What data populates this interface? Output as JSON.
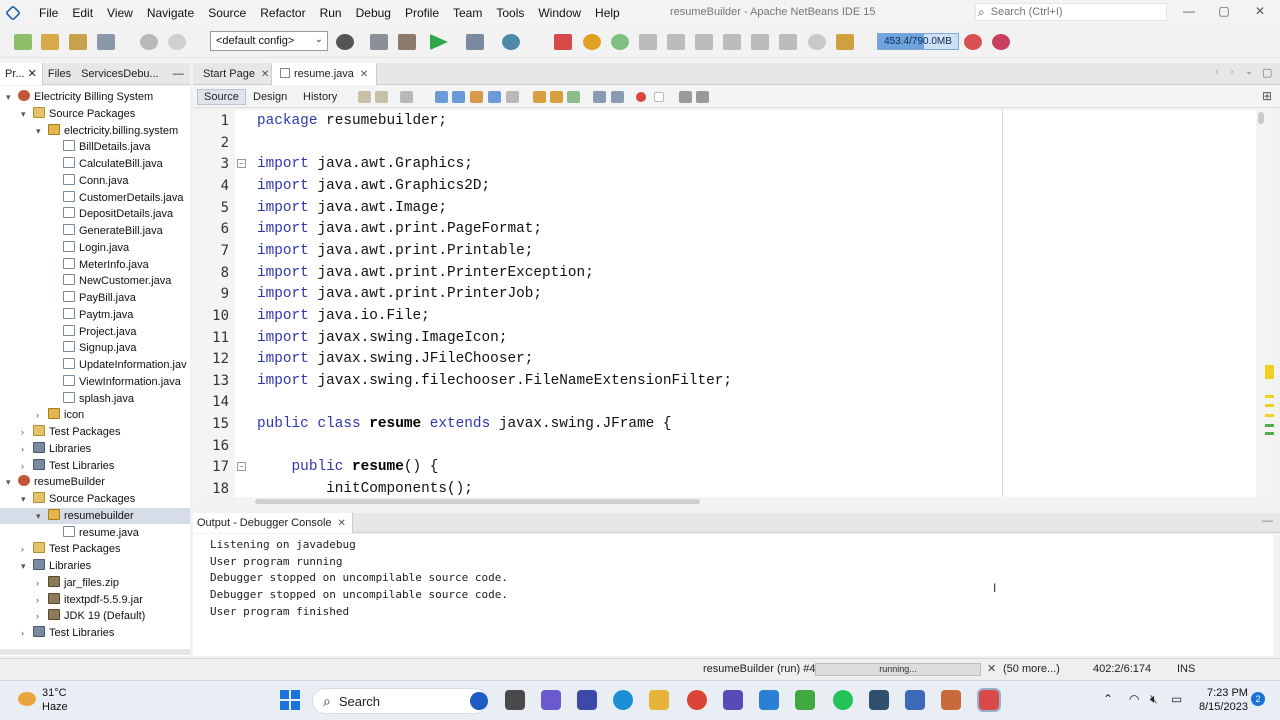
{
  "window": {
    "title": "resumeBuilder - Apache NetBeans IDE 15",
    "search_placeholder": "Search (Ctrl+I)"
  },
  "menu": [
    "File",
    "Edit",
    "View",
    "Navigate",
    "Source",
    "Refactor",
    "Run",
    "Debug",
    "Profile",
    "Team",
    "Tools",
    "Window",
    "Help"
  ],
  "toolbar": {
    "config": "<default config>",
    "memory": "453.4/790.0MB",
    "memory_fraction": 0.57
  },
  "projects_panel": {
    "tabs": [
      "Pr...",
      "Files",
      "ServicesDebu..."
    ],
    "tree": [
      {
        "label": "Electricity Billing System",
        "indent": 0,
        "icon": "project-icon",
        "twisty": "open"
      },
      {
        "label": "Source Packages",
        "indent": 1,
        "icon": "package-folder-icon",
        "twisty": "open"
      },
      {
        "label": "electricity.billing.system",
        "indent": 2,
        "icon": "package-icon",
        "twisty": "open"
      },
      {
        "label": "BillDetails.java",
        "indent": 3,
        "icon": "java-file-icon"
      },
      {
        "label": "CalculateBill.java",
        "indent": 3,
        "icon": "java-file-icon"
      },
      {
        "label": "Conn.java",
        "indent": 3,
        "icon": "java-file-icon"
      },
      {
        "label": "CustomerDetails.java",
        "indent": 3,
        "icon": "java-file-icon"
      },
      {
        "label": "DepositDetails.java",
        "indent": 3,
        "icon": "java-file-icon"
      },
      {
        "label": "GenerateBill.java",
        "indent": 3,
        "icon": "java-file-icon"
      },
      {
        "label": "Login.java",
        "indent": 3,
        "icon": "java-file-icon"
      },
      {
        "label": "MeterInfo.java",
        "indent": 3,
        "icon": "java-file-icon"
      },
      {
        "label": "NewCustomer.java",
        "indent": 3,
        "icon": "java-file-icon"
      },
      {
        "label": "PayBill.java",
        "indent": 3,
        "icon": "java-file-icon"
      },
      {
        "label": "Paytm.java",
        "indent": 3,
        "icon": "java-file-icon"
      },
      {
        "label": "Project.java",
        "indent": 3,
        "icon": "java-file-icon"
      },
      {
        "label": "Signup.java",
        "indent": 3,
        "icon": "java-file-icon"
      },
      {
        "label": "UpdateInformation.jav",
        "indent": 3,
        "icon": "java-file-icon"
      },
      {
        "label": "ViewInformation.java",
        "indent": 3,
        "icon": "java-file-icon"
      },
      {
        "label": "splash.java",
        "indent": 3,
        "icon": "java-file-icon"
      },
      {
        "label": "icon",
        "indent": 2,
        "icon": "package-icon",
        "twisty": "closed"
      },
      {
        "label": "Test Packages",
        "indent": 1,
        "icon": "package-folder-icon",
        "twisty": "closed"
      },
      {
        "label": "Libraries",
        "indent": 1,
        "icon": "library-icon",
        "twisty": "closed"
      },
      {
        "label": "Test Libraries",
        "indent": 1,
        "icon": "library-icon",
        "twisty": "closed"
      },
      {
        "label": "resumeBuilder",
        "indent": 0,
        "icon": "project-icon",
        "twisty": "open"
      },
      {
        "label": "Source Packages",
        "indent": 1,
        "icon": "package-folder-icon",
        "twisty": "open"
      },
      {
        "label": "resumebuilder",
        "indent": 2,
        "icon": "package-icon",
        "twisty": "open",
        "selected": true
      },
      {
        "label": "resume.java",
        "indent": 3,
        "icon": "java-file-icon"
      },
      {
        "label": "Test Packages",
        "indent": 1,
        "icon": "package-folder-icon",
        "twisty": "closed"
      },
      {
        "label": "Libraries",
        "indent": 1,
        "icon": "library-icon",
        "twisty": "open"
      },
      {
        "label": "jar_files.zip",
        "indent": 2,
        "icon": "jar-icon",
        "twisty": "closed"
      },
      {
        "label": "itextpdf-5.5.9.jar",
        "indent": 2,
        "icon": "jar-icon",
        "twisty": "closed"
      },
      {
        "label": "JDK 19 (Default)",
        "indent": 2,
        "icon": "jar-icon",
        "twisty": "closed"
      },
      {
        "label": "Test Libraries",
        "indent": 1,
        "icon": "library-icon",
        "twisty": "closed"
      }
    ]
  },
  "editor": {
    "tabs": [
      {
        "label": "Start Page",
        "active": false
      },
      {
        "label": "resume.java",
        "active": true
      }
    ],
    "views": [
      "Source",
      "Design",
      "History"
    ],
    "active_view": "Source",
    "lines": [
      {
        "n": "1",
        "parts": [
          [
            "kw",
            "package"
          ],
          [
            "",
            " resumebuilder;"
          ]
        ]
      },
      {
        "n": "2",
        "parts": []
      },
      {
        "n": "3",
        "parts": [
          [
            "kw",
            "import"
          ],
          [
            "",
            " java.awt.Graphics;"
          ]
        ],
        "fold": true
      },
      {
        "n": "4",
        "parts": [
          [
            "kw",
            "import"
          ],
          [
            "",
            " java.awt.Graphics2D;"
          ]
        ]
      },
      {
        "n": "5",
        "parts": [
          [
            "kw",
            "import"
          ],
          [
            "",
            " java.awt.Image;"
          ]
        ]
      },
      {
        "n": "6",
        "parts": [
          [
            "kw",
            "import"
          ],
          [
            "",
            " java.awt.print.PageFormat;"
          ]
        ]
      },
      {
        "n": "7",
        "parts": [
          [
            "kw",
            "import"
          ],
          [
            "",
            " java.awt.print.Printable;"
          ]
        ]
      },
      {
        "n": "8",
        "parts": [
          [
            "kw",
            "import"
          ],
          [
            "",
            " java.awt.print.PrinterException;"
          ]
        ]
      },
      {
        "n": "9",
        "parts": [
          [
            "kw",
            "import"
          ],
          [
            "",
            " java.awt.print.PrinterJob;"
          ]
        ]
      },
      {
        "n": "10",
        "parts": [
          [
            "kw",
            "import"
          ],
          [
            "",
            " java.io.File;"
          ]
        ]
      },
      {
        "n": "11",
        "parts": [
          [
            "kw",
            "import"
          ],
          [
            "",
            " javax.swing.ImageIcon;"
          ]
        ]
      },
      {
        "n": "12",
        "parts": [
          [
            "kw",
            "import"
          ],
          [
            "",
            " javax.swing.JFileChooser;"
          ]
        ]
      },
      {
        "n": "13",
        "parts": [
          [
            "kw",
            "import"
          ],
          [
            "",
            " javax.swing.filechooser.FileNameExtensionFilter;"
          ]
        ]
      },
      {
        "n": "14",
        "parts": []
      },
      {
        "n": "15",
        "parts": [
          [
            "kw",
            "public class"
          ],
          [
            "",
            " "
          ],
          [
            "bd",
            "resume"
          ],
          [
            "",
            " "
          ],
          [
            "kw",
            "extends"
          ],
          [
            "",
            " javax.swing.JFrame {"
          ]
        ]
      },
      {
        "n": "16",
        "parts": []
      },
      {
        "n": "17",
        "parts": [
          [
            "",
            "    "
          ],
          [
            "kw",
            "public"
          ],
          [
            "",
            " "
          ],
          [
            "bd",
            "resume"
          ],
          [
            "",
            "() {"
          ]
        ],
        "fold": true
      },
      {
        "n": "18",
        "parts": [
          [
            "",
            "        initComponents();"
          ]
        ]
      }
    ]
  },
  "output": {
    "tab": "Output - Debugger Console",
    "lines": [
      "Listening on javadebug",
      "User program running",
      "Debugger stopped on uncompilable source code.",
      "Debugger stopped on uncompilable source code.",
      "User program finished"
    ]
  },
  "status": {
    "task": "resumeBuilder (run) #4",
    "progress_label": "running...",
    "more": "(50 more...)",
    "caret": "402:2/6:174",
    "mode": "INS"
  },
  "taskbar": {
    "temp": "31°C",
    "weather": "Haze",
    "search": "Search",
    "time": "7:23 PM",
    "date": "8/15/2023",
    "notifications": "2"
  }
}
